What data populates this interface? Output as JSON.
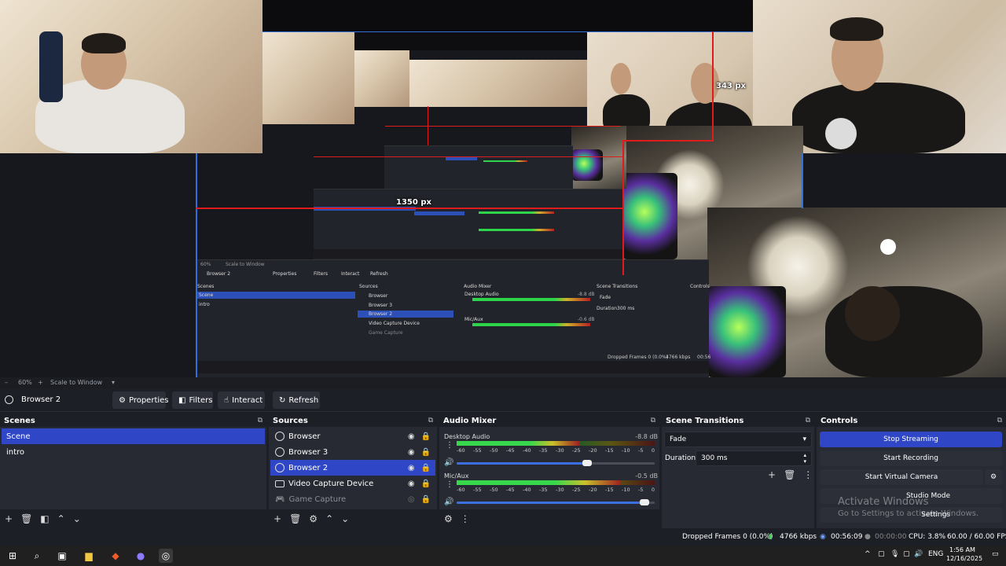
{
  "preview": {
    "labels": {
      "px_343": "343 px",
      "px_1350": "1350 px"
    },
    "nested": {
      "source_name": "Browser 2",
      "buttons": [
        "Properties",
        "Filters",
        "Interact",
        "Refresh"
      ],
      "zoom": "60%",
      "scale_to_window": "Scale to Window",
      "scenes_title": "Scenes",
      "sources_title": "Sources",
      "mixer_title": "Audio Mixer",
      "transitions_title": "Scene Transitions",
      "controls_title": "Controls",
      "scenes": [
        "Scene",
        "intro"
      ],
      "sources": [
        "Browser",
        "Browser 3",
        "Browser 2",
        "Video Capture Device",
        "Game Capture"
      ],
      "desktop_audio": "Desktop Audio",
      "desktop_db": "-8.8 dB",
      "mic_aux": "Mic/Aux",
      "mic_db": "-0.6 dB",
      "fade": "Fade",
      "duration": "Duration",
      "duration_value": "300 ms",
      "dropped": "Dropped Frames 0 (0.0%)",
      "kbps": "4766 kbps",
      "time_partial": "00:56"
    }
  },
  "zoombar": {
    "zoom": "60%",
    "scale": "Scale to Window"
  },
  "toolbar": {
    "source_name": "Browser 2",
    "properties": "Properties",
    "filters": "Filters",
    "interact": "Interact",
    "refresh": "Refresh"
  },
  "scenes": {
    "title": "Scenes",
    "items": [
      "Scene",
      "intro"
    ]
  },
  "sources": {
    "title": "Sources",
    "items": [
      "Browser",
      "Browser 3",
      "Browser 2",
      "Video Capture Device",
      "Game Capture"
    ]
  },
  "mixer": {
    "title": "Audio Mixer",
    "channels": [
      {
        "name": "Desktop Audio",
        "db": "-8.8 dB",
        "level": 0.62,
        "volume": 0.66
      },
      {
        "name": "Mic/Aux",
        "db": "-0.5 dB",
        "level": 0.83,
        "volume": 0.95
      }
    ],
    "ticks": [
      "-60",
      "-55",
      "-50",
      "-45",
      "-40",
      "-35",
      "-30",
      "-25",
      "-20",
      "-15",
      "-10",
      "-5",
      "0"
    ]
  },
  "transitions": {
    "title": "Scene Transitions",
    "selected": "Fade",
    "duration_label": "Duration",
    "duration_value": "300 ms"
  },
  "controls": {
    "title": "Controls",
    "stop_streaming": "Stop Streaming",
    "start_recording": "Start Recording",
    "start_virtual_camera": "Start Virtual Camera",
    "studio_mode": "Studio Mode",
    "settings": "Settings",
    "watermark_title": "Activate Windows",
    "watermark_sub": "Go to Settings to activate Windows."
  },
  "status": {
    "dropped": "Dropped Frames 0 (0.0%)",
    "kbps": "4766 kbps",
    "stream_time": "00:56:09",
    "rec_time": "00:00:00",
    "cpu": "CPU: 3.8%",
    "fps": "60.00 / 60.00 FPS"
  },
  "taskbar": {
    "lang": "ENG",
    "time": "1:56 AM",
    "date": "12/16/2025"
  },
  "colors": {
    "accent": "#2f47c7",
    "meter_green": "#37d84b",
    "meter_yellow": "#c9c02a",
    "meter_red": "#9e2020",
    "guide_red": "#e01b1b"
  }
}
